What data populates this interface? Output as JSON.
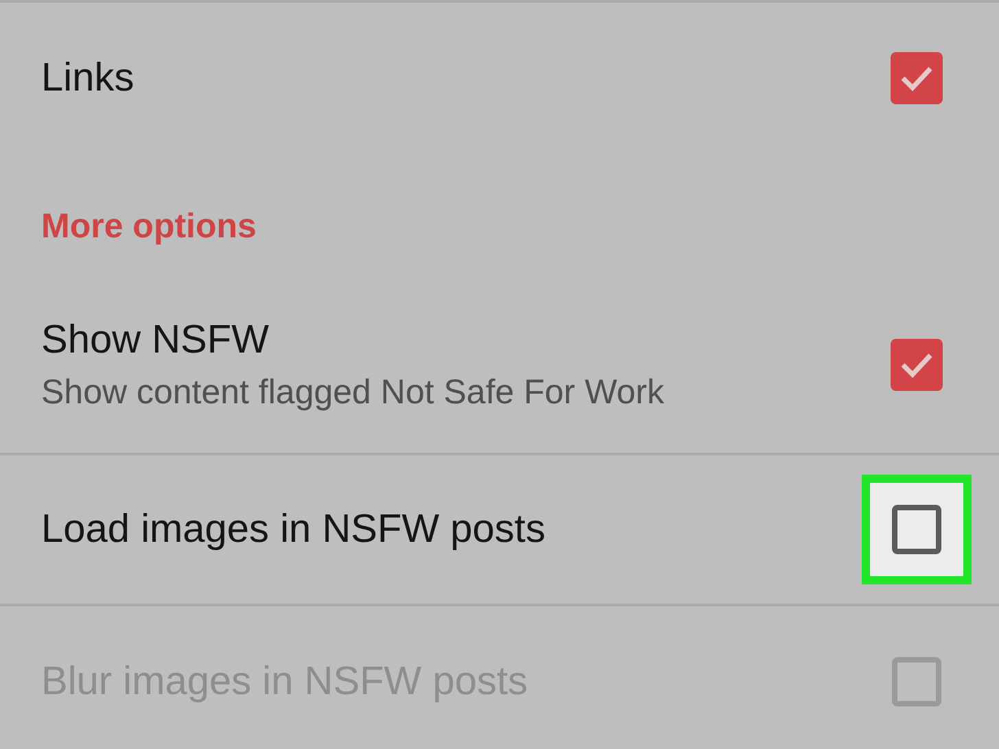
{
  "settings": [
    {
      "kind": "checkbox",
      "title": "Links",
      "checked": true,
      "divider": false,
      "highlighted": false,
      "disabled": false
    },
    {
      "kind": "header",
      "title": "More options"
    },
    {
      "kind": "checkbox",
      "title": "Show NSFW",
      "summary": "Show content flagged Not Safe For Work",
      "checked": true,
      "divider": true,
      "highlighted": false,
      "disabled": false
    },
    {
      "kind": "checkbox",
      "title": "Load images in NSFW posts",
      "checked": false,
      "divider": true,
      "highlighted": true,
      "disabled": false
    },
    {
      "kind": "checkbox",
      "title": "Blur images in NSFW posts",
      "checked": false,
      "divider": false,
      "highlighted": false,
      "disabled": true
    }
  ]
}
